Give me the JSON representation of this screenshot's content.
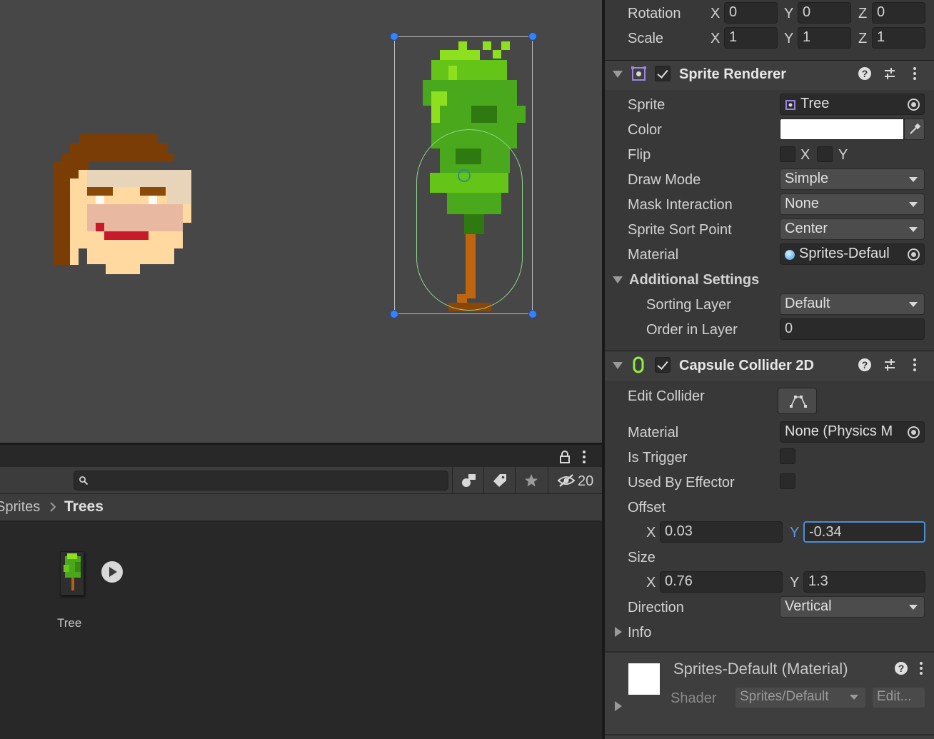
{
  "project": {
    "breadcrumb": [
      "Sprites",
      "Trees"
    ],
    "hidden_packages_count": "20",
    "search": {
      "value": "",
      "placeholder": ""
    },
    "assets": [
      {
        "label": "Tree"
      }
    ]
  },
  "inspector": {
    "transform": {
      "rotation": {
        "label": "Rotation",
        "x": "0",
        "y": "0",
        "z": "0"
      },
      "scale": {
        "label": "Scale",
        "x": "1",
        "y": "1",
        "z": "1"
      }
    },
    "axes": {
      "x": "X",
      "y": "Y",
      "z": "Z"
    },
    "sprite_renderer": {
      "title": "Sprite Renderer",
      "enabled": true,
      "sprite": {
        "label": "Sprite",
        "value": "Tree"
      },
      "color": {
        "label": "Color",
        "value": "#ffffff"
      },
      "flip": {
        "label": "Flip",
        "x_label": "X",
        "y_label": "Y"
      },
      "draw_mode": {
        "label": "Draw Mode",
        "value": "Simple"
      },
      "mask_interaction": {
        "label": "Mask Interaction",
        "value": "None"
      },
      "sprite_sort_point": {
        "label": "Sprite Sort Point",
        "value": "Center"
      },
      "material": {
        "label": "Material",
        "value": "Sprites-Defaul"
      },
      "additional_settings": {
        "label": "Additional Settings",
        "sorting_layer": {
          "label": "Sorting Layer",
          "value": "Default"
        },
        "order_in_layer": {
          "label": "Order in Layer",
          "value": "0"
        }
      }
    },
    "capsule_collider": {
      "title": "Capsule Collider 2D",
      "enabled": true,
      "edit_collider": {
        "label": "Edit Collider"
      },
      "material": {
        "label": "Material",
        "value": "None (Physics M"
      },
      "is_trigger": {
        "label": "Is Trigger",
        "checked": false
      },
      "used_by_effector": {
        "label": "Used By Effector",
        "checked": false
      },
      "offset": {
        "label": "Offset",
        "x": "0.03",
        "y": "-0.34"
      },
      "size": {
        "label": "Size",
        "x": "0.76",
        "y": "1.3"
      },
      "direction": {
        "label": "Direction",
        "value": "Vertical"
      },
      "info": {
        "label": "Info"
      }
    },
    "material_footer": {
      "title": "Sprites-Default (Material)",
      "shader_label": "Shader",
      "shader_value": "Sprites/Default",
      "edit_label": "Edit..."
    }
  },
  "colors": {
    "scene_bg": "#474747",
    "panel_bg": "#383838",
    "selection_handle": "#3a82f0",
    "collider_outline": "#8fd68a",
    "focus": "#4c8dd4"
  }
}
